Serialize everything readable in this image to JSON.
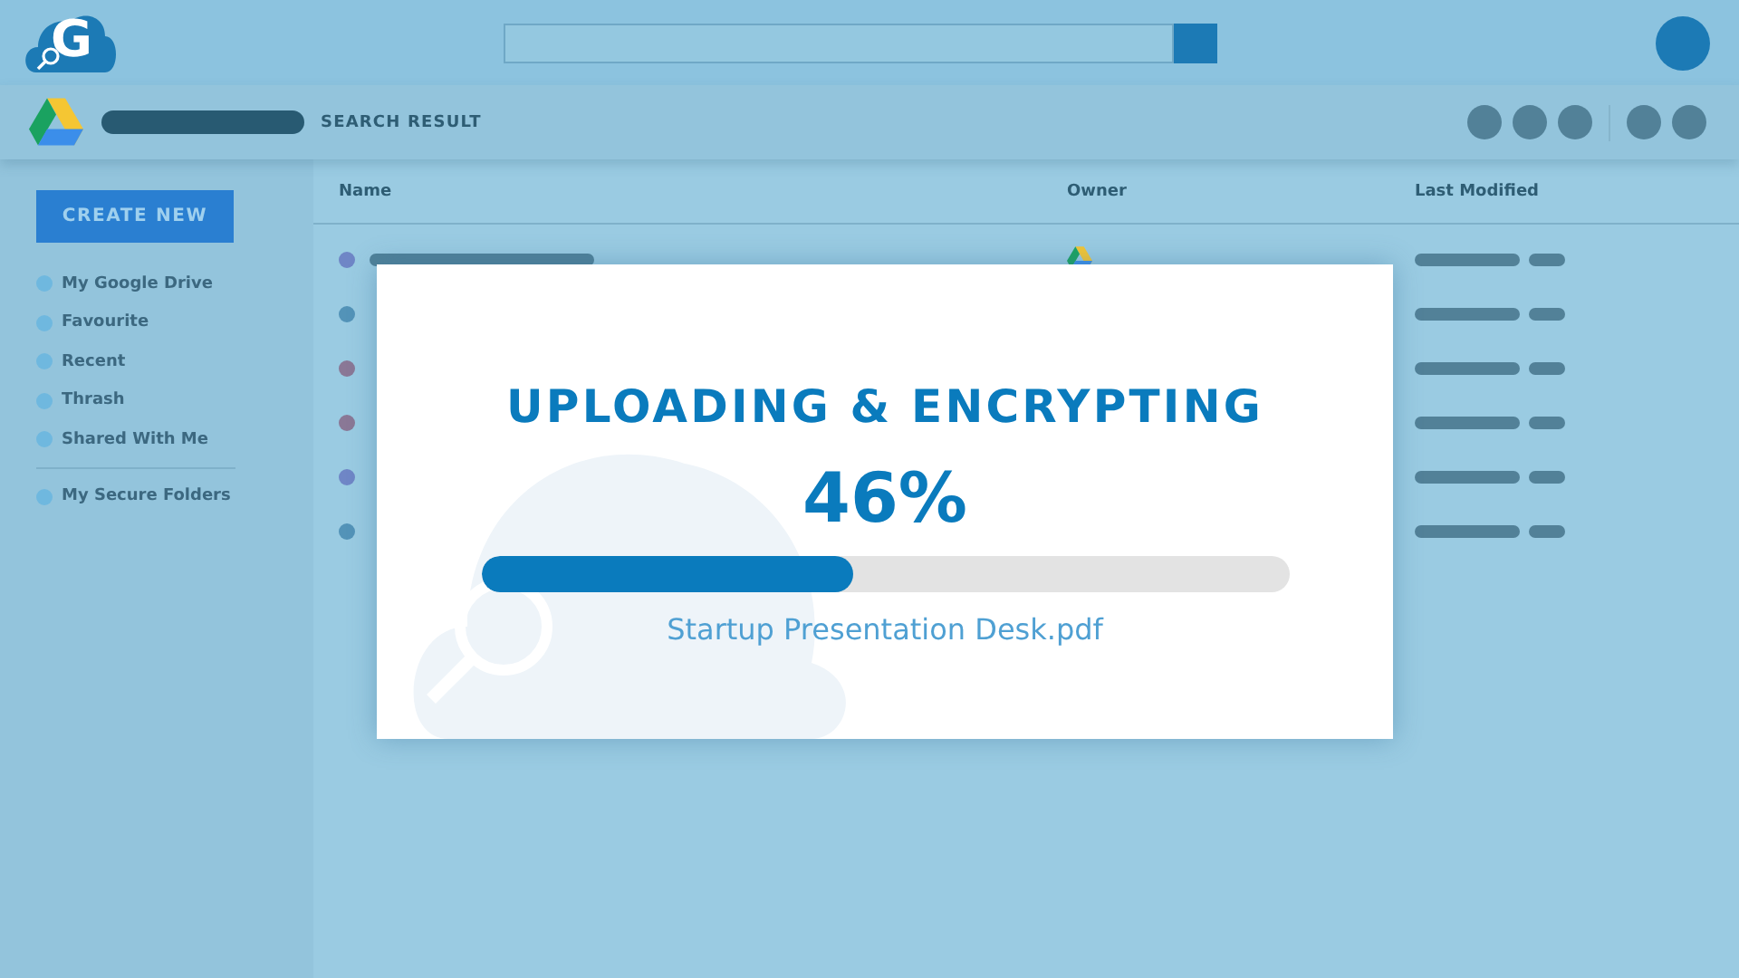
{
  "header": {
    "logo_letter": "G"
  },
  "toolbar": {
    "title": "SEARCH RESULT"
  },
  "sidebar": {
    "create_button": "CREATE NEW",
    "items": [
      {
        "label": "My Google Drive"
      },
      {
        "label": "Favourite"
      },
      {
        "label": "Recent"
      },
      {
        "label": "Thrash"
      },
      {
        "label": "Shared With Me"
      }
    ],
    "secure_items": [
      {
        "label": "My Secure Folders"
      }
    ]
  },
  "table": {
    "columns": [
      "Name",
      "Owner",
      "Last Modified"
    ],
    "rows": [
      {
        "color": "#6f86c6"
      },
      {
        "color": "#5393b8"
      },
      {
        "color": "#8a7896"
      },
      {
        "color": "#8a7896"
      },
      {
        "color": "#6f86c6"
      },
      {
        "color": "#5393b8"
      }
    ]
  },
  "dialog": {
    "title": "UPLOADING & ENCRYPTING",
    "percent": "46%",
    "level": 0.46,
    "file_name": "Startup Presentation Desk.pdf"
  }
}
